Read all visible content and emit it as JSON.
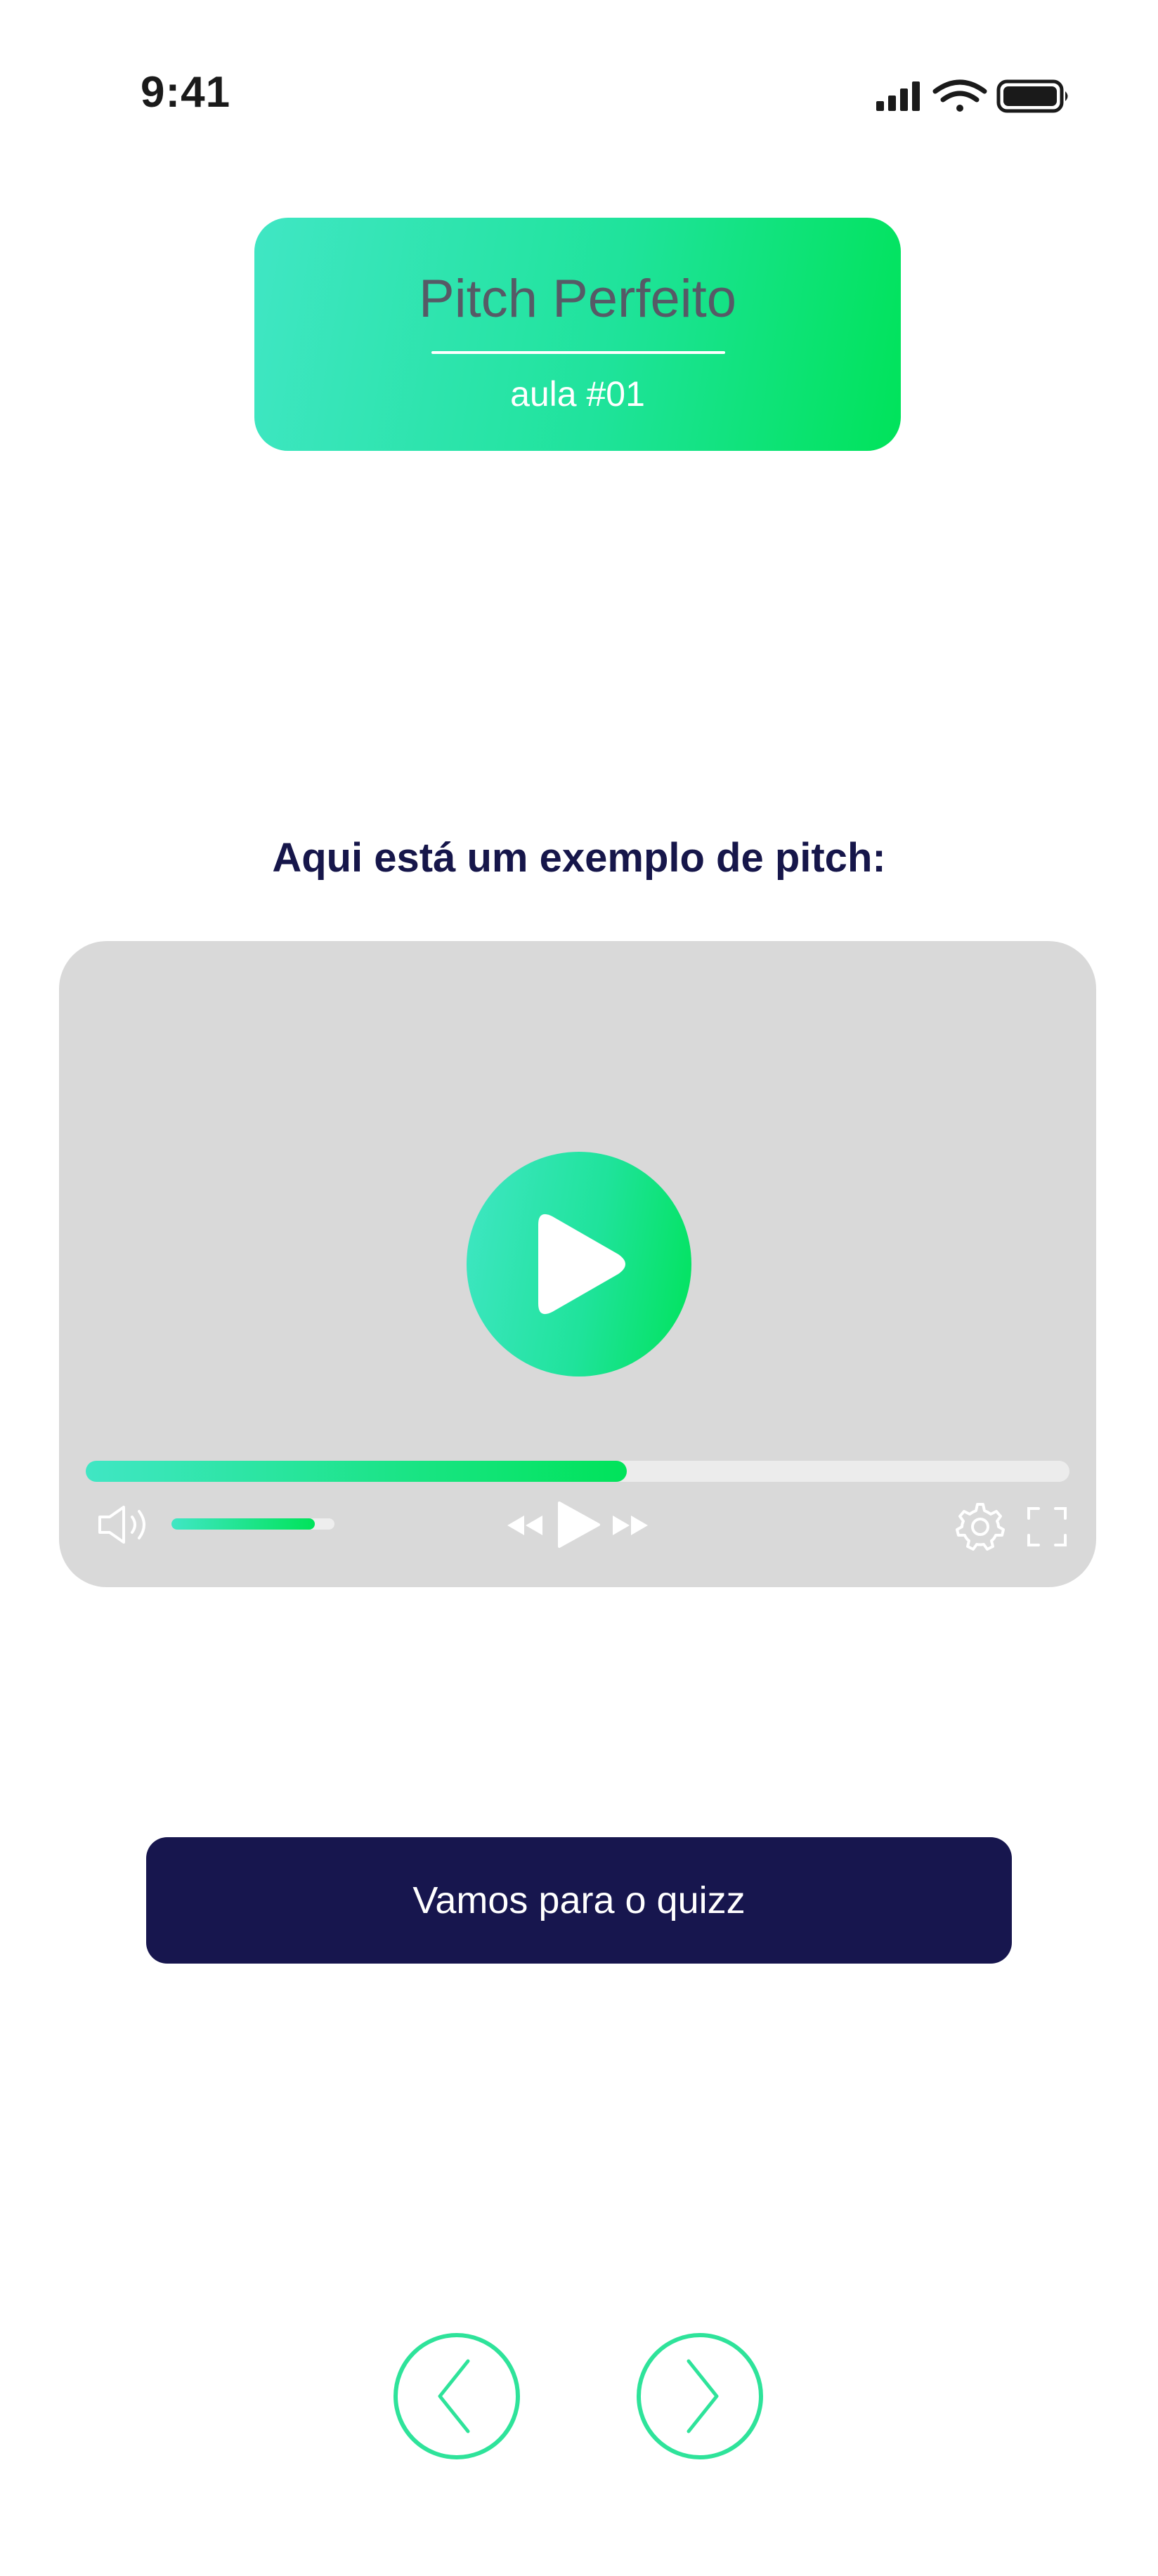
{
  "status_bar": {
    "time": "9:41",
    "icons": [
      "cellular-signal-icon",
      "wifi-icon",
      "battery-icon"
    ]
  },
  "lesson": {
    "title": "Pitch Perfeito",
    "subtitle": "aula #01"
  },
  "content": {
    "heading": "Aqui está um exemplo de pitch:"
  },
  "video": {
    "progress": 0.55,
    "volume": 0.88,
    "controls": [
      "volume-icon",
      "rewind-icon",
      "play-icon",
      "fast-forward-icon",
      "settings-icon",
      "fullscreen-icon"
    ]
  },
  "actions": {
    "quiz_button": "Vamos para o quizz"
  },
  "navigation": {
    "prev": "chevron-left-icon",
    "next": "chevron-right-icon"
  },
  "colors": {
    "accent_start": "#40e6c4",
    "accent_end": "#00e35a",
    "navy": "#17164e",
    "player_bg": "#d9d9d9",
    "title_gray": "#565a66"
  }
}
